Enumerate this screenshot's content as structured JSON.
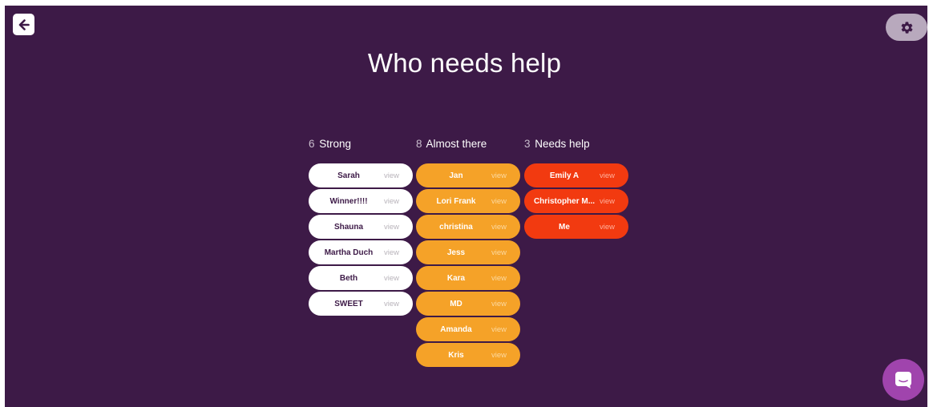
{
  "page": {
    "title": "Who needs help"
  },
  "toolbar": {
    "back_icon": "arrow-left-icon",
    "settings_icon": "gear-icon"
  },
  "columns": {
    "strong": {
      "count": "6",
      "label": "Strong",
      "students": [
        {
          "name": "Sarah",
          "action": "view"
        },
        {
          "name": "Winner!!!!",
          "action": "view"
        },
        {
          "name": "Shauna",
          "action": "view"
        },
        {
          "name": "Martha Duch",
          "action": "view"
        },
        {
          "name": "Beth",
          "action": "view"
        },
        {
          "name": "SWEET",
          "action": "view"
        }
      ]
    },
    "almost": {
      "count": "8",
      "label": "Almost there",
      "students": [
        {
          "name": "Jan",
          "action": "view"
        },
        {
          "name": "Lori Frank",
          "action": "view"
        },
        {
          "name": "christina",
          "action": "view"
        },
        {
          "name": "Jess",
          "action": "view"
        },
        {
          "name": "Kara",
          "action": "view"
        },
        {
          "name": "MD",
          "action": "view"
        },
        {
          "name": "Amanda",
          "action": "view"
        },
        {
          "name": "Kris",
          "action": "view"
        }
      ]
    },
    "needs": {
      "count": "3",
      "label": "Needs help",
      "students": [
        {
          "name": "Emily A",
          "action": "view"
        },
        {
          "name": "Christopher M...",
          "action": "view"
        },
        {
          "name": "Me",
          "action": "view"
        }
      ]
    }
  },
  "colors": {
    "background": "#3d1a47",
    "strong": "#ffffff",
    "almost_there": "#f5a228",
    "needs_help": "#f23a10",
    "chat_button": "#a044ad"
  },
  "chat": {
    "icon": "chat-bubble-icon"
  }
}
